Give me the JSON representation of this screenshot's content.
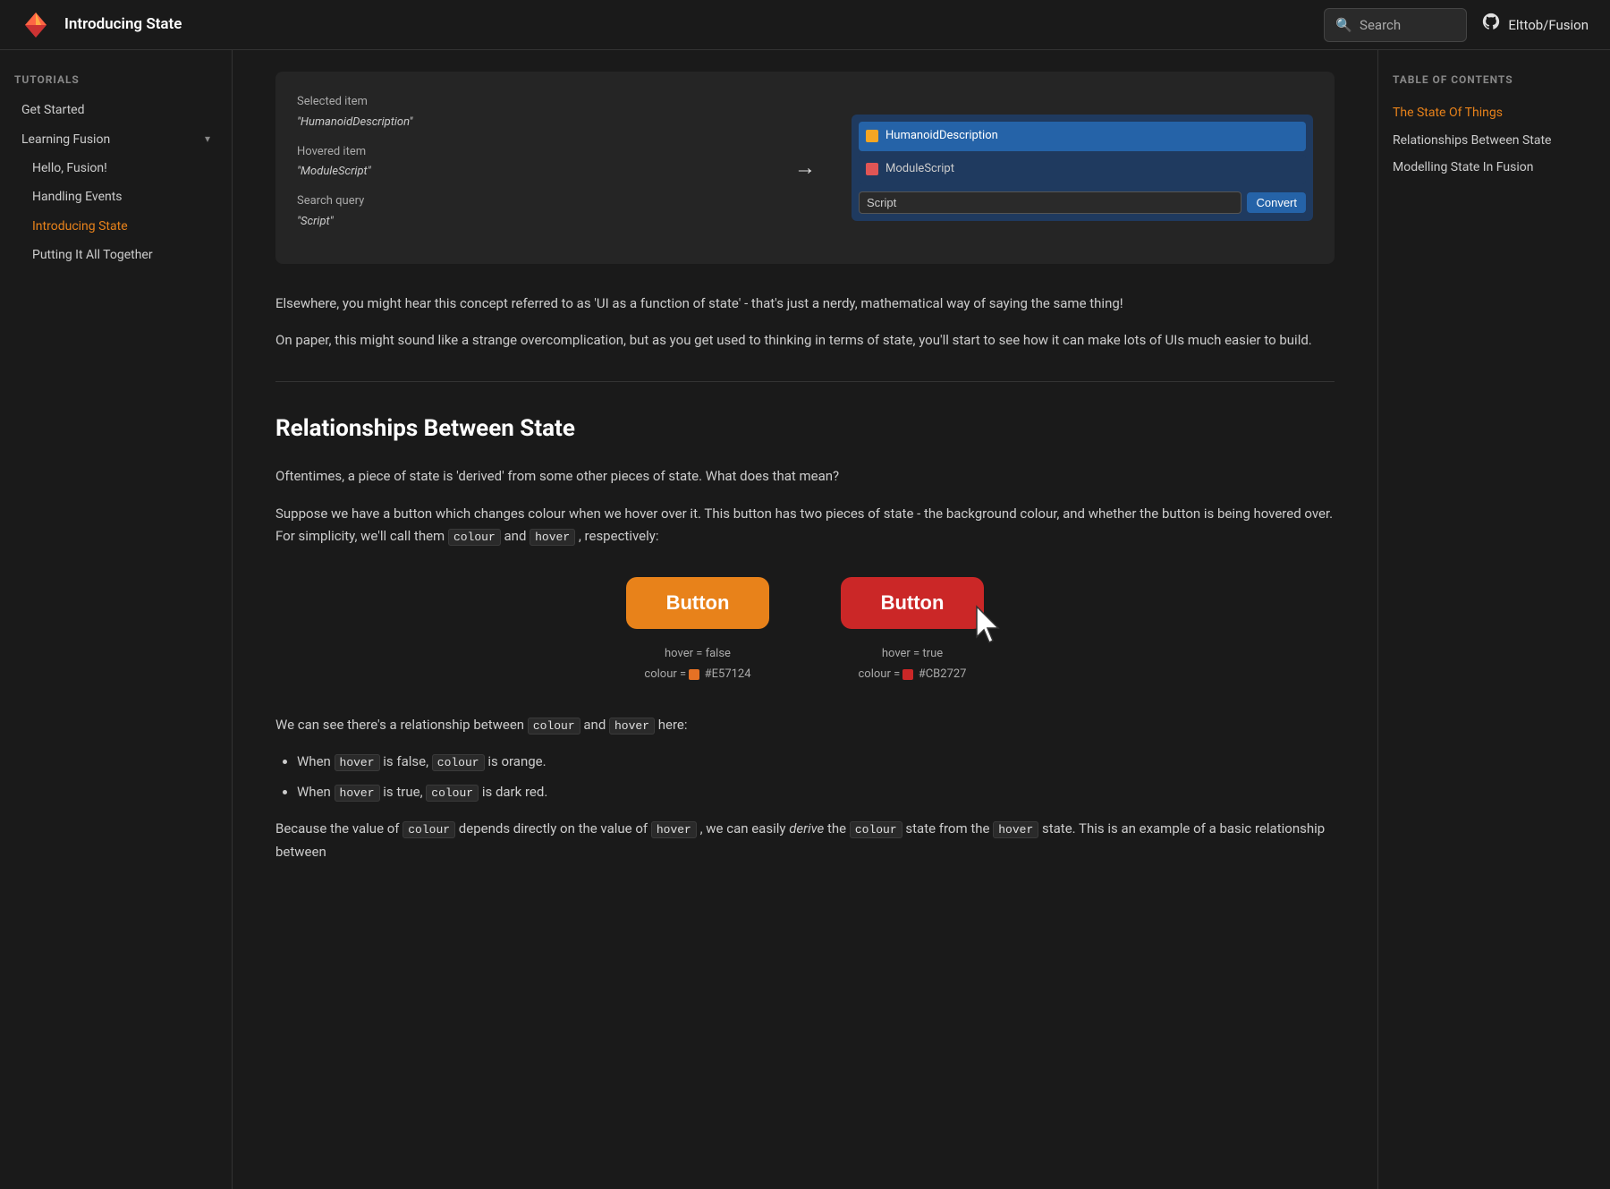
{
  "header": {
    "title": "Introducing State",
    "search_placeholder": "Search",
    "github_label": "Elttob/Fusion"
  },
  "sidebar_left": {
    "section_label": "Tutorials",
    "items": [
      {
        "id": "get-started",
        "label": "Get Started",
        "active": false,
        "group": false
      },
      {
        "id": "learning-fusion",
        "label": "Learning Fusion",
        "active": false,
        "group": true,
        "children": [
          {
            "id": "hello-fusion",
            "label": "Hello, Fusion!",
            "active": false
          },
          {
            "id": "handling-events",
            "label": "Handling Events",
            "active": false
          },
          {
            "id": "introducing-state",
            "label": "Introducing State",
            "active": true
          },
          {
            "id": "putting-it-all-together",
            "label": "Putting It All Together",
            "active": false
          }
        ]
      }
    ]
  },
  "demo_box": {
    "selected_item_label": "Selected item",
    "selected_item_value": "\"HumanoidDescription\"",
    "hovered_item_label": "Hovered item",
    "hovered_item_value": "\"ModuleScript\"",
    "search_query_label": "Search query",
    "search_query_value": "\"Script\"",
    "ui_rows": [
      {
        "label": "HumanoidDescription",
        "selected": true,
        "icon_type": "humanoid"
      },
      {
        "label": "ModuleScript",
        "selected": false,
        "icon_type": "module"
      }
    ],
    "search_input_value": "Script",
    "convert_button_label": "Convert"
  },
  "toc": {
    "title": "Table of contents",
    "items": [
      {
        "id": "the-state-of-things",
        "label": "The State Of Things",
        "active": true
      },
      {
        "id": "relationships-between-state",
        "label": "Relationships Between State",
        "active": false
      },
      {
        "id": "modelling-state-in-fusion",
        "label": "Modelling State In Fusion",
        "active": false
      }
    ]
  },
  "content": {
    "para1": "Elsewhere, you might hear this concept referred to as 'UI as a function of state' - that's just a nerdy, mathematical way of saying the same thing!",
    "para2": "On paper, this might sound like a strange overcomplication, but as you get used to thinking in terms of state, you'll start to see how it can make lots of UIs much easier to build.",
    "section2_heading": "Relationships Between State",
    "para3": "Oftentimes, a piece of state is 'derived' from some other pieces of state. What does that mean?",
    "para4": "Suppose we have a button which changes colour when we hover over it. This button has two pieces of state - the background colour, and whether the button is being hovered over. For simplicity, we'll call them",
    "code_colour": "colour",
    "code_hover": "hover",
    "para4_end": "and",
    "para4_end2": ", respectively:",
    "btn_label": "Button",
    "btn_left_state": "hover = false",
    "btn_left_colour_label": "colour =",
    "btn_left_colour_value": "#E57124",
    "btn_right_state": "hover = true",
    "btn_right_colour_label": "colour =",
    "btn_right_colour_value": "#CB2727",
    "para5_start": "We can see there's a relationship between",
    "code_colour2": "colour",
    "para5_mid": "and",
    "code_hover2": "hover",
    "para5_end": "here:",
    "list_items": [
      {
        "prefix": "When ",
        "code": "hover",
        "middle": " is false, ",
        "code2": "colour",
        "suffix": " is orange."
      },
      {
        "prefix": "When ",
        "code": "hover",
        "middle": " is true, ",
        "code2": "colour",
        "suffix": " is dark red."
      }
    ],
    "para6_start": "Because the value of",
    "code_colour3": "colour",
    "para6_mid": "depends directly on the value of",
    "code_hover3": "hover",
    "para6_mid2": ", we can easily",
    "italic_derive": "derive",
    "para6_end": "the",
    "code_colour4": "colour",
    "para6_end2": "state from the",
    "code_hover4": "hover",
    "para6_end3": "state. This is an example of a basic relationship between"
  },
  "colors": {
    "orange": "#E57124",
    "red": "#CB2727",
    "accent": "#e8821a",
    "toc_active": "#e8821a",
    "sidebar_active": "#e8821a"
  }
}
